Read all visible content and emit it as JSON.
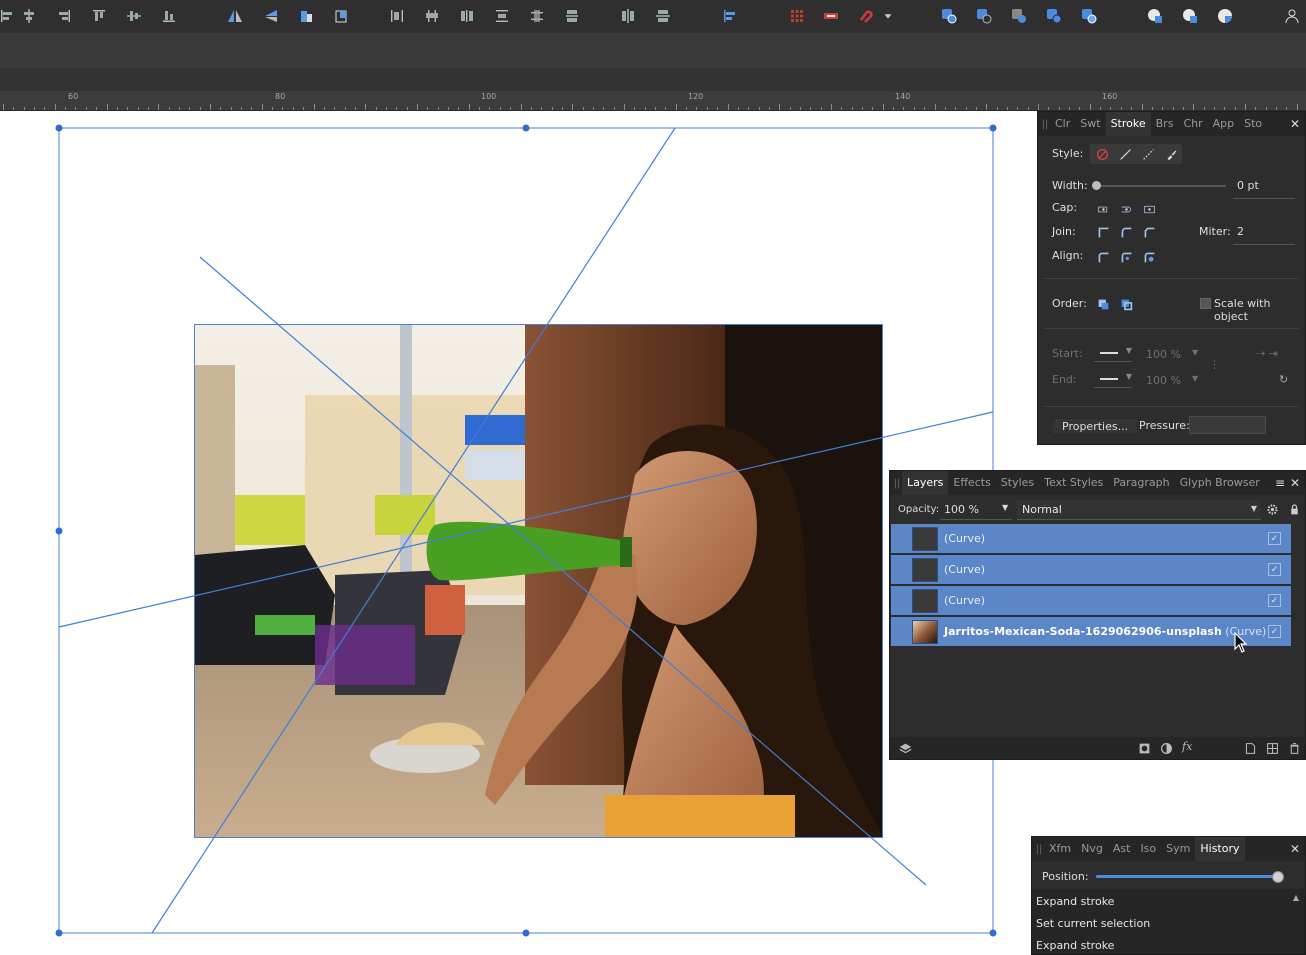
{
  "toolbar": {
    "groups": [
      [
        "align-left-icon",
        "align-center-icon",
        "align-right-icon",
        "align-top-icon",
        "align-middle-icon",
        "align-bottom-icon"
      ],
      [
        "flip-horizontal-icon",
        "flip-vertical-icon",
        "rotate-left-icon",
        "rotate-right-icon"
      ],
      [
        "distribute-h1-icon",
        "distribute-h2-icon",
        "distribute-h3-icon",
        "distribute-v1-icon",
        "distribute-v2-icon",
        "distribute-v3-icon"
      ],
      [
        "space-h-icon",
        "space-v-icon"
      ],
      [
        "align-dropdown-icon"
      ],
      [
        "grid-icon",
        "snap-red-icon",
        "magnet-icon",
        "snap-options-icon"
      ],
      [
        "add-boolean-icon",
        "subtract-boolean-icon",
        "intersect-boolean-icon",
        "xor-boolean-icon",
        "divide-boolean-icon"
      ],
      [
        "geometry-add-icon",
        "geometry-sub-icon",
        "geometry-intersect-icon"
      ],
      [
        "persona-icon"
      ]
    ]
  },
  "ruler": {
    "labels": [
      "60",
      "80",
      "100",
      "120",
      "140",
      "160"
    ]
  },
  "stroke_panel": {
    "tabs": [
      "Clr",
      "Swt",
      "Stroke",
      "Brs",
      "Chr",
      "App",
      "Sto"
    ],
    "active_tab": "Stroke",
    "style_label": "Style:",
    "width_label": "Width:",
    "width_value": "0 pt",
    "cap_label": "Cap:",
    "join_label": "Join:",
    "miter_label": "Miter:",
    "miter_value": "2",
    "align_label": "Align:",
    "order_label": "Order:",
    "scale_label": "Scale with object",
    "start_label": "Start:",
    "end_label": "End:",
    "start_scale": "100 %",
    "end_scale": "100 %",
    "properties_button": "Properties...",
    "pressure_label": "Pressure:"
  },
  "layers_panel": {
    "tabs": [
      "Layers",
      "Effects",
      "Styles",
      "Text Styles",
      "Paragraph",
      "Glyph Browser"
    ],
    "active_tab": "Layers",
    "opacity_label": "Opacity:",
    "opacity_value": "100 %",
    "blend_mode": "Normal",
    "layers": [
      {
        "name": "(Curve)",
        "bold": "",
        "suffix": "",
        "thumb": "dark"
      },
      {
        "name": "(Curve)",
        "bold": "",
        "suffix": "",
        "thumb": "dark"
      },
      {
        "name": "(Curve)",
        "bold": "",
        "suffix": "",
        "thumb": "dark"
      },
      {
        "name": "",
        "bold": "Jarritos-Mexican-Soda-1629062906-unsplash",
        "suffix": " (Curve)",
        "thumb": "photo"
      }
    ]
  },
  "history_panel": {
    "tabs": [
      "Xfm",
      "Nvg",
      "Ast",
      "Iso",
      "Sym",
      "History"
    ],
    "active_tab": "History",
    "position_label": "Position:",
    "position_fraction": 0.98,
    "items": [
      "Expand stroke",
      "Set current selection",
      "Expand stroke"
    ]
  },
  "colors": {
    "selection": "#3f7fd8",
    "panel_bg": "#2d2d2d",
    "layer_selected": "#5b86c7"
  }
}
